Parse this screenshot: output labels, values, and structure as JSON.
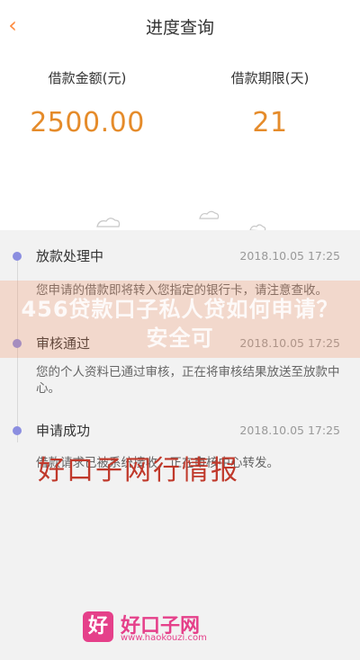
{
  "header": {
    "title": "进度查询",
    "back_icon": "‹"
  },
  "summary": {
    "amount_label": "借款金额(元)",
    "amount_value": "2500.00",
    "term_label": "借款期限(天)",
    "term_value": "21"
  },
  "timeline": [
    {
      "title": "放款处理中",
      "time": "2018.10.05 17:25",
      "desc": "您申请的借款即将转入您指定的银行卡，请注意查收。"
    },
    {
      "title": "审核通过",
      "time": "2018.10.05 17:25",
      "desc": "您的个人资料已通过审核，正在将审核结果放送至放款中心。"
    },
    {
      "title": "申请成功",
      "time": "2018.10.05 17:25",
      "desc": "借款请求已被系统接收，正在审核中心转发。"
    }
  ],
  "watermark": {
    "banner_text": "456贷款口子私人贷如何申请？安全可",
    "red_text": "好口子网行情报"
  },
  "logo": {
    "badge": "好",
    "name": "好口子网",
    "url": "www.haokouzi.com"
  },
  "colors": {
    "accent": "#e58b2a",
    "dot": "#8b8ee0",
    "logo": "#e5408a"
  }
}
